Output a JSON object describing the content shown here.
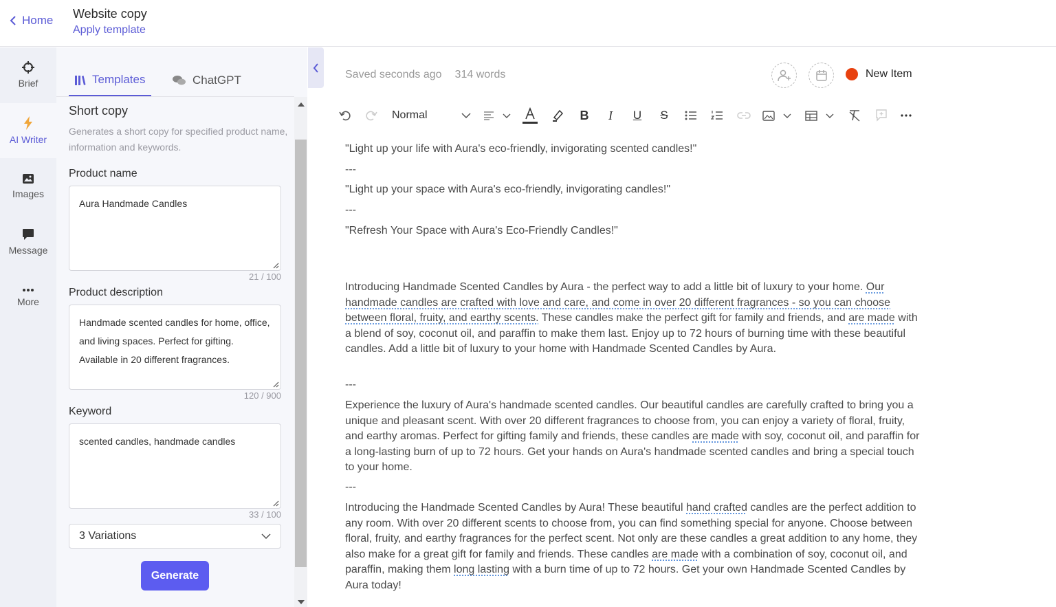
{
  "header": {
    "home_label": "Home",
    "doc_title": "Website copy",
    "apply_template_label": "Apply template"
  },
  "rail": {
    "items": [
      {
        "label": "Brief",
        "icon": "crosshair-icon"
      },
      {
        "label": "AI Writer",
        "icon": "lightning-icon"
      },
      {
        "label": "Images",
        "icon": "image-icon"
      },
      {
        "label": "Message",
        "icon": "chat-bubble-icon"
      },
      {
        "label": "More",
        "icon": "ellipsis-icon"
      }
    ],
    "active_index": 1
  },
  "panel": {
    "tabs": [
      {
        "label": "Templates",
        "icon": "books-icon"
      },
      {
        "label": "ChatGPT",
        "icon": "chat-bubbles-icon"
      }
    ],
    "section_title": "Short copy",
    "section_desc": "Generates a short copy for specified product name, information and keywords.",
    "fields": [
      {
        "label": "Product name",
        "value": "Aura Handmade Candles",
        "counter": "21 / 100"
      },
      {
        "label": "Product description",
        "value": "Handmade scented candles for home, office, and living spaces. Perfect for gifting. Available in 20 different fragrances.",
        "counter": "120 / 900"
      },
      {
        "label": "Keyword",
        "value": "scented candles, handmade candles",
        "counter": "33 / 100"
      }
    ],
    "variations": "3 Variations",
    "generate_label": "Generate"
  },
  "editor": {
    "saved_status": "Saved seconds ago",
    "word_count": "314 words",
    "new_item_label": "New Item",
    "status_color": "#e8410f",
    "toolbar": {
      "style_value": "Normal",
      "icons": [
        "undo-icon",
        "redo-icon",
        "align-icon",
        "font-color-icon",
        "highlighter-icon",
        "bold-icon",
        "italic-icon",
        "underline-icon",
        "strikethrough-icon",
        "bullet-list-icon",
        "numbered-list-icon",
        "link-icon",
        "image-icon",
        "table-icon",
        "clear-format-icon",
        "comment-icon",
        "more-icon"
      ]
    },
    "lines": {
      "l1": "\"Light up your life with Aura's eco-friendly, invigorating scented candles!\"",
      "sep1": "---",
      "l2": "\"Light up your space with Aura's eco-friendly, invigorating candles!\"",
      "sep2": "---",
      "l3": "\"Refresh Your Space with Aura's Eco-Friendly Candles!\"",
      "p1a": "Introducing Handmade Scented Candles by Aura - the perfect way to add a little bit of luxury to your home. ",
      "p1b": "Our handmade candles are crafted with love and care, and come in over 20 different fragrances - so you can choose between floral, fruity, and earthy scents.",
      "p1c": " These candles make the perfect gift for family and friends, and ",
      "p1d": "are made",
      "p1e": " with a blend of soy, coconut oil, and paraffin to make them last. Enjoy up to 72 hours of burning time with these beautiful candles. Add a little bit of luxury to your home with Handmade Scented Candles by Aura.",
      "sep3": "---",
      "p2a": "Experience the luxury of Aura's handmade scented candles. Our beautiful candles are carefully crafted to bring you a unique and pleasant scent. With over 20 different fragrances to choose from, you can enjoy a variety of floral, fruity, and earthy aromas. Perfect for gifting family and friends, these candles ",
      "p2b": "are made",
      "p2c": " with soy, coconut oil, and paraffin for a long-lasting burn of up to 72 hours. Get your hands on Aura's handmade scented candles and bring a special touch to your home.",
      "sep4": "---",
      "p3a": "Introducing the Handmade Scented Candles by Aura! These beautiful ",
      "p3b": "hand crafted",
      "p3c": " candles are the perfect addition to any room. With over 20 different scents to choose from, you can find something special for anyone. Choose between floral, fruity, and earthy fragrances for the perfect scent. Not only are these candles a great addition to any home, they also make for a great gift for family and friends. These candles ",
      "p3d": "are made",
      "p3e": " with a combination of soy, coconut oil, and paraffin, making them ",
      "p3f": "long lasting",
      "p3g": " with a burn time of up to 72 hours. Get your own Handmade Scented Candles by Aura today!"
    }
  }
}
